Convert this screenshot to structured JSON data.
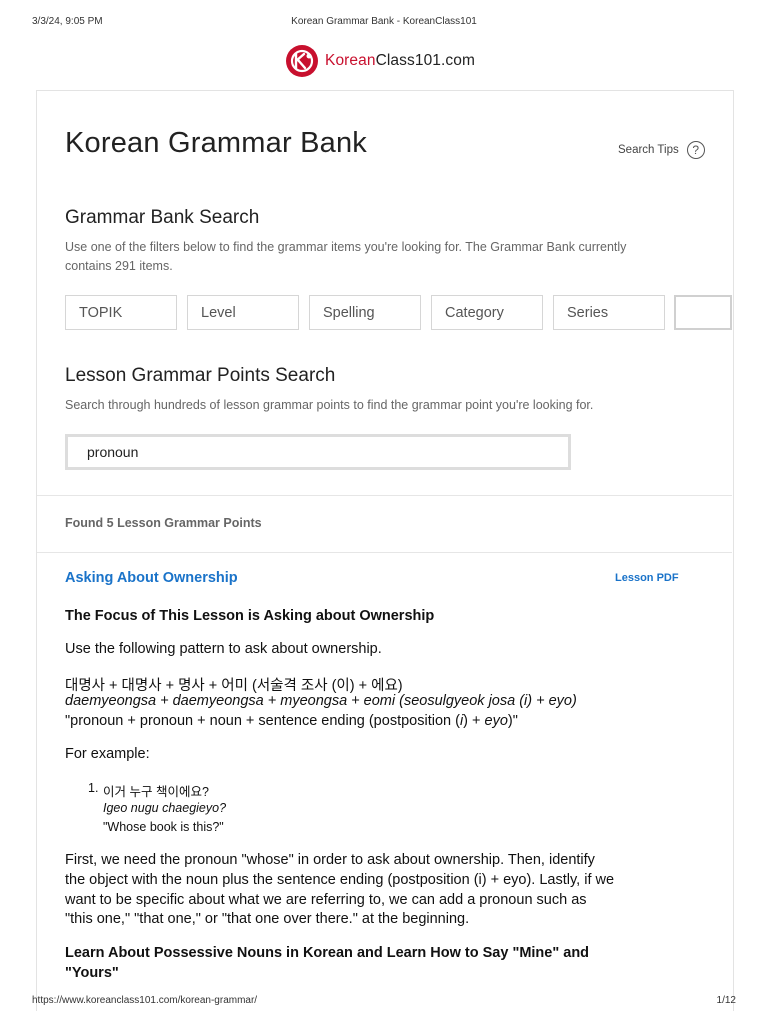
{
  "print": {
    "datetime": "3/3/24, 9:05 PM",
    "doc_title": "Korean Grammar Bank - KoreanClass101",
    "url": "https://www.koreanclass101.com/korean-grammar/",
    "page": "1/12"
  },
  "logo": {
    "word_red": "Korean",
    "word_dark": "Class101.com"
  },
  "header": {
    "title": "Korean Grammar Bank",
    "search_tips": "Search Tips",
    "help_glyph": "?"
  },
  "grammar_bank": {
    "heading": "Grammar Bank Search",
    "desc_line1": "Use one of the filters below to find the grammar items you're looking for. The Grammar Bank currently",
    "desc_line2": "contains 291 items.",
    "filters": [
      "TOPIK",
      "Level",
      "Spelling",
      "Category",
      "Series"
    ]
  },
  "lesson_search": {
    "heading": "Lesson Grammar Points Search",
    "desc": "Search through hundreds of lesson grammar points to find the grammar point you're looking for.",
    "query": "pronoun"
  },
  "results": {
    "found": "Found 5 Lesson Grammar Points",
    "items": [
      {
        "title": "Asking About Ownership",
        "pdf_label": "Lesson PDF",
        "focus": "The Focus of This Lesson is Asking about Ownership",
        "intro": "Use the following pattern to ask about ownership.",
        "pattern_korean": "대명사 + 대명사 + 명사 + 어미 (서술격 조사 (이) + 에요)",
        "pattern_roman": "daemyeongsa + daemyeongsa + myeongsa + eomi (seosulgyeok josa (i) + eyo)",
        "pattern_en_a": "\"pronoun  + pronoun  + noun + sentence ending (postposition (",
        "pattern_en_i": "i",
        "pattern_en_b": ") + ",
        "pattern_en_eyo": "eyo",
        "pattern_en_c": ")\"",
        "for_example": "For example:",
        "example_num": "1.",
        "example_korean": "이거 누구 책이에요?",
        "example_roman": "Igeo nugu chaegieyo?",
        "example_en": "\"Whose book is this?\"",
        "para_line1": "First, we need the pronoun  \"whose\" in order to ask about ownership. Then, identify",
        "para_line2": "the object with the noun plus the sentence ending (postposition (i) + eyo). Lastly, if we",
        "para_line3": "want to be specific about what we are referring to, we can add a pronoun  such as",
        "para_line4": "\"this one,\" \"that one,\" or \"that one over there.\" at the beginning.",
        "subheading_line1": "Learn About Possessive Nouns in Korean and Learn How to Say \"Mine\" and",
        "subheading_line2": "\"Yours\""
      }
    ]
  },
  "colors": {
    "brand_red": "#c8102e",
    "link_blue": "#1a73c9"
  }
}
